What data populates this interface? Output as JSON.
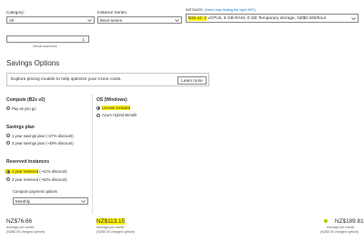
{
  "top": {
    "category": {
      "label": "Category:",
      "value": "All"
    },
    "series": {
      "label": "Instance Series:",
      "value": "Bsv2-series"
    },
    "instance": {
      "label": "INSTANCE:",
      "link": "(Need help finding the right VM?)",
      "value_highlight": "B2s v2: 2",
      "value_rest": " vCPUs, 8 GB RAM, 0 GB Temporary storage, NZ$0.260/hour"
    },
    "quantity": {
      "value": "1",
      "caption": "Virtual machines"
    }
  },
  "savings": {
    "title": "Savings Options",
    "banner_text": "Explore pricing models to help optimize your Azure costs.",
    "learn_more": "Learn more"
  },
  "compute": {
    "title": "Compute (B2s v2)",
    "pay_as_you_go": "Pay as you go"
  },
  "savings_plan": {
    "title": "Savings plan",
    "opt1": "1 year savings plan (~27% discount)",
    "opt2": "3 year savings plan (~49% discount)"
  },
  "reserved": {
    "title": "Reserved instances",
    "opt1": "1 year reserved",
    "opt1_rest": " (~41% discount)",
    "opt2": "3 year reserved (~62% discount)",
    "payment_label": "Compute payment options",
    "payment_value": "Monthly"
  },
  "os": {
    "title": "OS (Windows)",
    "opt1": "License included",
    "opt2": "Azure Hybrid Benefit"
  },
  "totals": {
    "t1": {
      "amount": "NZ$76.66",
      "caption": "Average per month",
      "upfront": "(NZ$0.00 charged upfront)"
    },
    "t2": {
      "amount": "NZ$113.15",
      "caption": "Average per month",
      "upfront": "(NZ$0.00 charged upfront)"
    },
    "t3": {
      "amount": "NZ$189.81",
      "caption": "Average per month",
      "upfront": "(NZ$0.00 charged upfront)"
    }
  },
  "colors": {
    "highlight": "#fff200",
    "accent": "#0078d4",
    "dot_green": "#b5c400"
  }
}
